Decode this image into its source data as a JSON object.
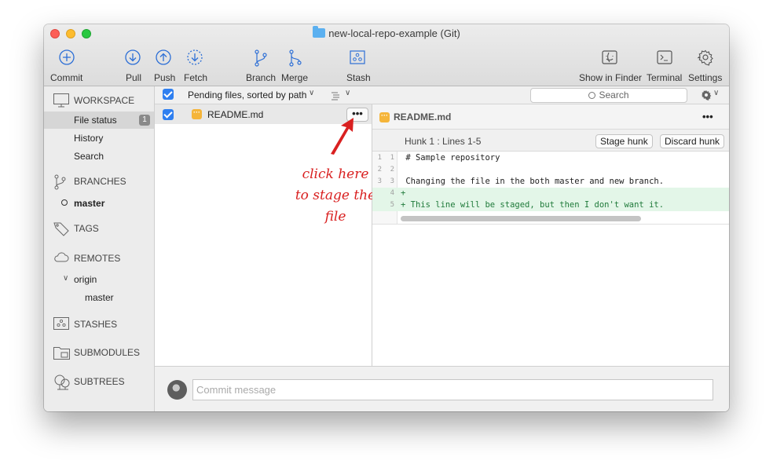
{
  "window": {
    "title": "new-local-repo-example (Git)"
  },
  "toolbar": {
    "commit": "Commit",
    "pull": "Pull",
    "push": "Push",
    "fetch": "Fetch",
    "branch": "Branch",
    "merge": "Merge",
    "stash": "Stash",
    "show_in_finder": "Show in Finder",
    "terminal": "Terminal",
    "settings": "Settings"
  },
  "sidebar": {
    "workspace": "WORKSPACE",
    "file_status": "File status",
    "file_status_count": "1",
    "history": "History",
    "search": "Search",
    "branches": "BRANCHES",
    "current_branch": "master",
    "tags": "TAGS",
    "remotes": "REMOTES",
    "remote_origin": "origin",
    "remote_branch": "master",
    "stashes": "STASHES",
    "submodules": "SUBMODULES",
    "subtrees": "SUBTREES"
  },
  "files": {
    "sort_label": "Pending files, sorted by path",
    "search_placeholder": "Search",
    "items": [
      {
        "name": "README.md"
      }
    ]
  },
  "annotation": {
    "line1": "click here",
    "line2": "to stage the",
    "line3": "file"
  },
  "diff": {
    "filename": "README.md",
    "hunk_title": "Hunk 1 : Lines 1-5",
    "stage_hunk": "Stage hunk",
    "discard_hunk": "Discard hunk",
    "lines": [
      {
        "old": "1",
        "new": "1",
        "text": " # Sample repository"
      },
      {
        "old": "2",
        "new": "2",
        "text": ""
      },
      {
        "old": "3",
        "new": "3",
        "text": " Changing the file in the both master and new branch."
      },
      {
        "old": "",
        "new": "4",
        "text": "+"
      },
      {
        "old": "",
        "new": "5",
        "text": "+ This line will be staged, but then I don't want it."
      }
    ]
  },
  "commit": {
    "placeholder": "Commit message"
  },
  "colors": {
    "accent": "#2f7ff0",
    "modified": "#f5b53a",
    "annotation": "#d92020",
    "added_bg": "#e3f6e8"
  }
}
